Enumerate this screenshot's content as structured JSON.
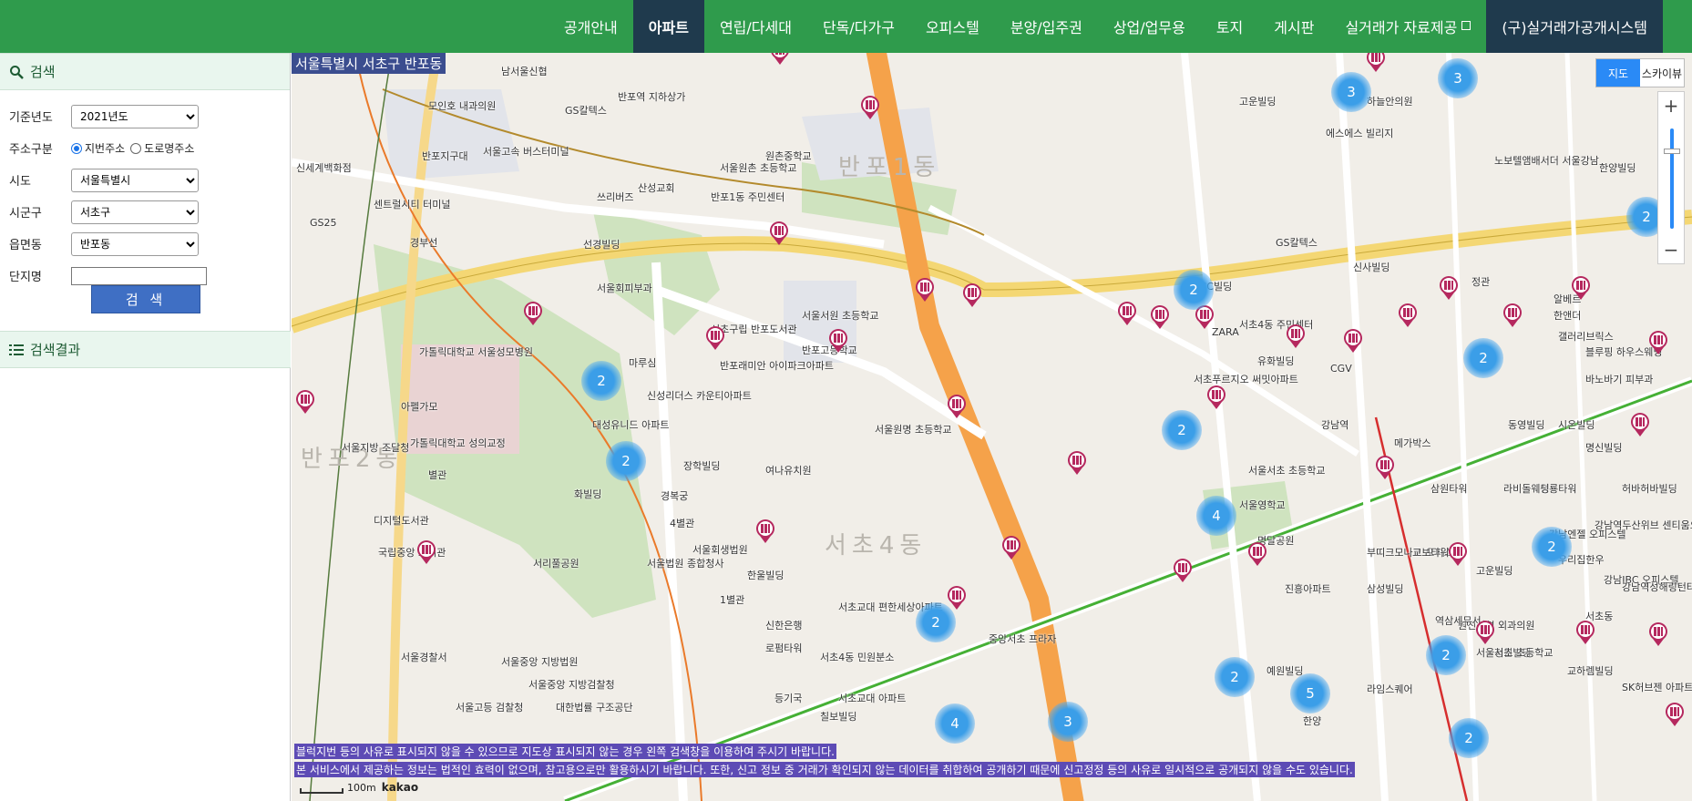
{
  "nav": {
    "items": [
      {
        "label": "공개안내"
      },
      {
        "label": "아파트"
      },
      {
        "label": "연립/다세대"
      },
      {
        "label": "단독/다가구"
      },
      {
        "label": "오피스텔"
      },
      {
        "label": "분양/입주권"
      },
      {
        "label": "상업/업무용"
      },
      {
        "label": "토지"
      },
      {
        "label": "게시판"
      },
      {
        "label": "실거래가 자료제공"
      },
      {
        "label": "(구)실거래가공개시스템"
      }
    ],
    "active": "아파트"
  },
  "search": {
    "title": "검색",
    "year_label": "기준년도",
    "year_value": "2021년도",
    "addr_label": "주소구분",
    "addr_opt1": "지번주소",
    "addr_opt2": "도로명주소",
    "sido_label": "시도",
    "sido_value": "서울특별시",
    "sigungu_label": "시군구",
    "sigungu_value": "서초구",
    "dong_label": "읍면동",
    "dong_value": "반포동",
    "danji_label": "단지명",
    "danji_value": "",
    "button": "검 색"
  },
  "results": {
    "title": "검색결과"
  },
  "map": {
    "area_label": "서울특별시 서초구 반포동",
    "tab_map": "지도",
    "tab_sky": "스카이뷰",
    "zoom_in": "+",
    "zoom_out": "−",
    "notice1": "블럭지번 등의 사유로 표시되지 않을 수 있으므로 지도상 표시되지 않는 경우 왼쪽 검색창을 이용하여 주시기 바랍니다.",
    "notice2": "본 서비스에서 제공하는 정보는 법적인 효력이 없으며, 참고용으로만 활용하시기 바랍니다. 또한, 신고 정보 중 거래가 확인되지 않는 데이터를 취합하여 공개하기 때문에 신고정정 등의 사유로 일시적으로 공개되지 않을 수도 있습니다.",
    "scale": "100m",
    "brand": "kakao",
    "dong_labels": [
      "반포1동",
      "반포2동",
      "서초4동"
    ],
    "clusters": [
      "2",
      "2",
      "3",
      "3",
      "2",
      "2",
      "2",
      "2",
      "4",
      "2",
      "2",
      "2",
      "5",
      "3",
      "4",
      "2",
      "2"
    ],
    "labels": [
      "남서울신협",
      "반포역 지하상가",
      "모인호 내과의원",
      "GS칼텍스",
      "반포지구대",
      "서울고속 버스터미널",
      "신세계백화점",
      "센트럴시티 터미널",
      "GS25",
      "경부선",
      "쓰리버즈",
      "산성교회",
      "반포1동 주민센터",
      "원촌중학교",
      "서울원촌 초등학교",
      "선경빌딩",
      "서울회피부과",
      "서초구립 반포도서관",
      "가톨릭대학교 서울성모병원",
      "마루심",
      "반포래미안 아이파크아파트",
      "신성리더스 카운티아파트",
      "서울서원 초등학교",
      "반포고등학교",
      "대성유니드 아파트",
      "아펠가모",
      "가톨릭대학교 성의교정",
      "별관",
      "장학빌딩",
      "여나유치원",
      "서울지방 조달청",
      "화빌딩",
      "경복궁",
      "4별관",
      "서울회생법원",
      "디지털도서관",
      "국립중앙 도서관",
      "서리풀공원",
      "서울법원 종합청사",
      "1별관",
      "한울빌딩",
      "신한은행",
      "로펌타워",
      "서초4동 민원분소",
      "서초교대 편한세상아파트",
      "중앙서초 프라자",
      "서울원명 초등학교",
      "서울서초 초등학교",
      "서울영학교",
      "명달공원",
      "서초푸르지오 써밋아파트",
      "진흥아파트",
      "부띠크모나코 오피스텔",
      "삼성빌딩",
      "고운빌딩",
      "강남역",
      "메가박스",
      "원진성형 외과의원",
      "교보타워",
      "강남IBC 오피스텔",
      "역삼세무서",
      "청원빌딩",
      "서초동",
      "서울경찰서",
      "서울중앙 지방법원",
      "서울중앙 지방검찰청",
      "서울고등 검찰청",
      "대한법률 구조공단",
      "칠보빌딩",
      "노보텔앰배서더 서울강남",
      "에스에스 빌리지",
      "하늘안의원",
      "고운빌딩",
      "한양빌딩",
      "동영빌딩",
      "서초4동 주민센터",
      "KCC빌딩",
      "ZARA",
      "유화빌딩",
      "CGV",
      "GS칼텍스",
      "신사빌딩",
      "정관",
      "알베르",
      "한앤더",
      "갤러리브릭스",
      "블루핑 하우스웨딩",
      "바노바기 피부과",
      "시온빌딩",
      "명신빌딩",
      "허바허바빌딩",
      "성룡타워",
      "삼원타워",
      "강남역두산위브 센티움오피스텔",
      "강남엔젤 오피스텔",
      "참진한의원",
      "라비돌웨딩",
      "우리집한우",
      "강남역성해링턴타워 더퍼스트오피스텔",
      "서울서초 초등학교",
      "교하렘빌딩",
      "SK허브젠 아파트",
      "라임스퀘어",
      "한양",
      "영동빌딩",
      "트리플렉스 오피스텔",
      "예원빌딩",
      "등기국",
      "서초교대 아파트"
    ]
  }
}
